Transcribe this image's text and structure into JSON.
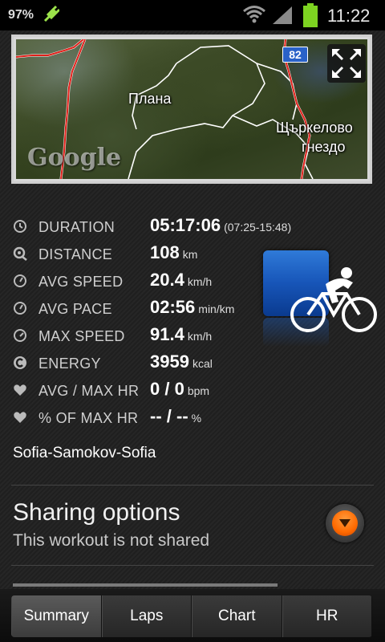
{
  "status_bar": {
    "battery_percent": "97%",
    "time": "11:22",
    "icons": [
      "charging-plug-icon",
      "wifi-icon",
      "signal-icon",
      "battery-icon"
    ]
  },
  "map": {
    "labels": {
      "village": "Плана",
      "place_line1": "Щъркелово",
      "place_line2": "гнездо"
    },
    "road_number": "82",
    "provider": "Google"
  },
  "stats": [
    {
      "icon": "clock-icon",
      "label": "DURATION",
      "value": "05:17:06",
      "unit": "(07:25-15:48)"
    },
    {
      "icon": "distance-icon",
      "label": "DISTANCE",
      "value": "108",
      "unit": "km"
    },
    {
      "icon": "speedometer-icon",
      "label": "AVG SPEED",
      "value": "20.4",
      "unit": "km/h"
    },
    {
      "icon": "speedometer-icon",
      "label": "AVG PACE",
      "value": "02:56",
      "unit": "min/km"
    },
    {
      "icon": "speedometer-icon",
      "label": "MAX SPEED",
      "value": "91.4",
      "unit": "km/h"
    },
    {
      "icon": "energy-icon",
      "label": "ENERGY",
      "value": "3959",
      "unit": "kcal"
    },
    {
      "icon": "heart-icon",
      "label": "AVG / MAX HR",
      "value": "0 / 0",
      "unit": "bpm"
    },
    {
      "icon": "heart-icon",
      "label": "% OF MAX HR",
      "value": "-- / --",
      "unit": "%"
    }
  ],
  "sport": {
    "icon": "cycling-icon"
  },
  "workout_name": "Sofia-Samokov-Sofia",
  "sharing": {
    "title": "Sharing options",
    "subtitle": "This workout is not shared"
  },
  "tabs": [
    {
      "label": "Summary",
      "active": true
    },
    {
      "label": "Laps",
      "active": false
    },
    {
      "label": "Chart",
      "active": false
    },
    {
      "label": "HR",
      "active": false
    }
  ],
  "colors": {
    "route": "#e0201a",
    "accent_orange": "#ff6a00",
    "sport_blue": "#1f63c7",
    "battery_green": "#7dd321"
  }
}
